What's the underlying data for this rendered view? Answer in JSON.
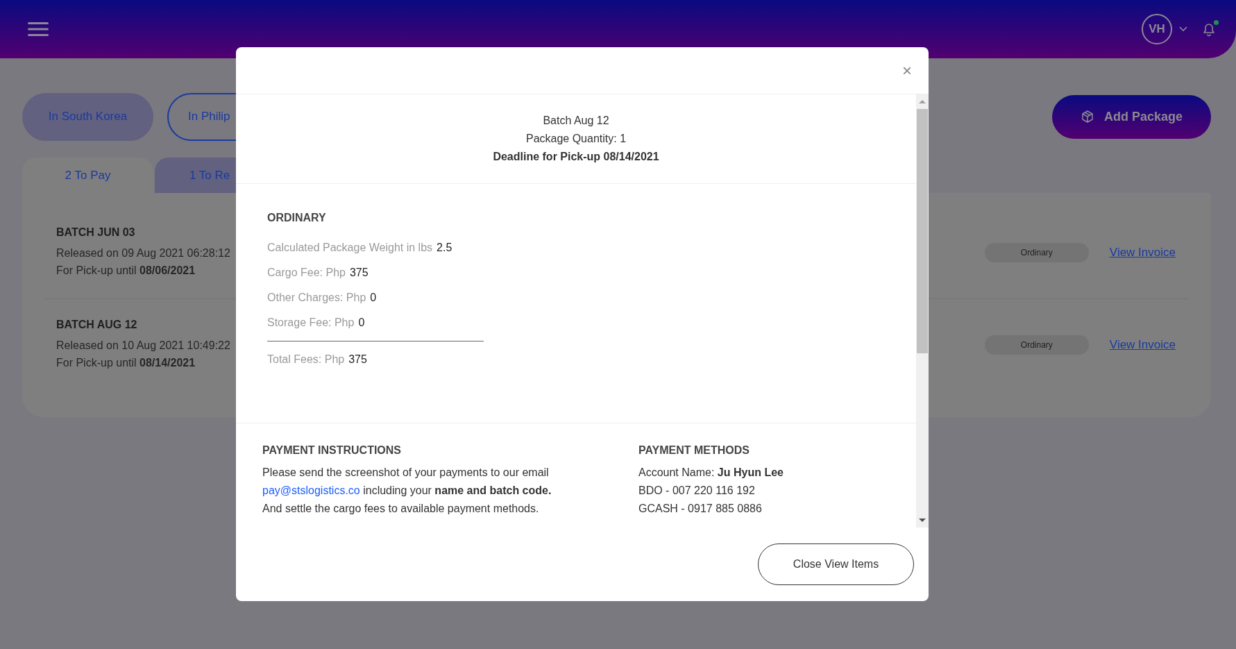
{
  "header": {
    "avatar_initials": "VH",
    "notification_dot": true
  },
  "location_pills": [
    {
      "label": "In South Korea",
      "selected": true
    },
    {
      "label": "In Philip",
      "selected": false
    }
  ],
  "add_button": {
    "label": "Add Package"
  },
  "tabs": [
    {
      "label": "2 To Pay",
      "selected": true
    },
    {
      "label": "1 To Re",
      "selected": false
    }
  ],
  "batches": [
    {
      "title": "BATCH JUN 03",
      "released": "Released on 09 Aug 2021 06:28:12",
      "pickup": "For Pick-up until **08/06/2021**",
      "badge": "Ordinary",
      "link": "View Invoice"
    },
    {
      "title": "BATCH AUG 12",
      "released": "Released on 10 Aug 2021 10:49:22",
      "pickup": "For Pick-up until **08/14/2021**",
      "badge": "Ordinary",
      "link": "View Invoice"
    }
  ],
  "modal": {
    "close": "×",
    "summary": [
      "Batch Aug 12",
      "Package Quantity: 1",
      "Deadline for Pick-up 08/14/2021"
    ],
    "category": "ORDINARY",
    "fees": [
      {
        "label": "Calculated Package Weight in lbs",
        "value": "2.5"
      },
      {
        "label": "Cargo Fee: Php",
        "value": "375"
      },
      {
        "label": "Other Charges: Php",
        "value": "0"
      },
      {
        "label": "Storage Fee: Php",
        "value": "0"
      }
    ],
    "total": {
      "label": "Total Fees: Php",
      "value": "375"
    },
    "instructions": {
      "heading": "PAYMENT INSTRUCTIONS",
      "line_1": "Please send the screenshot of your payments to our email",
      "email": "pay@stslogistics.co",
      "line_2": "including your **name and batch code.**",
      "line_3": "And settle the cargo fees to available payment methods."
    },
    "methods": {
      "heading": "PAYMENT METHODS",
      "lines": [
        "Account Name: **Ju Hyun Lee**",
        "BDO - 007 220 116 192",
        "GCASH - 0917 885 0886"
      ]
    },
    "close_button": "Close View Items"
  }
}
